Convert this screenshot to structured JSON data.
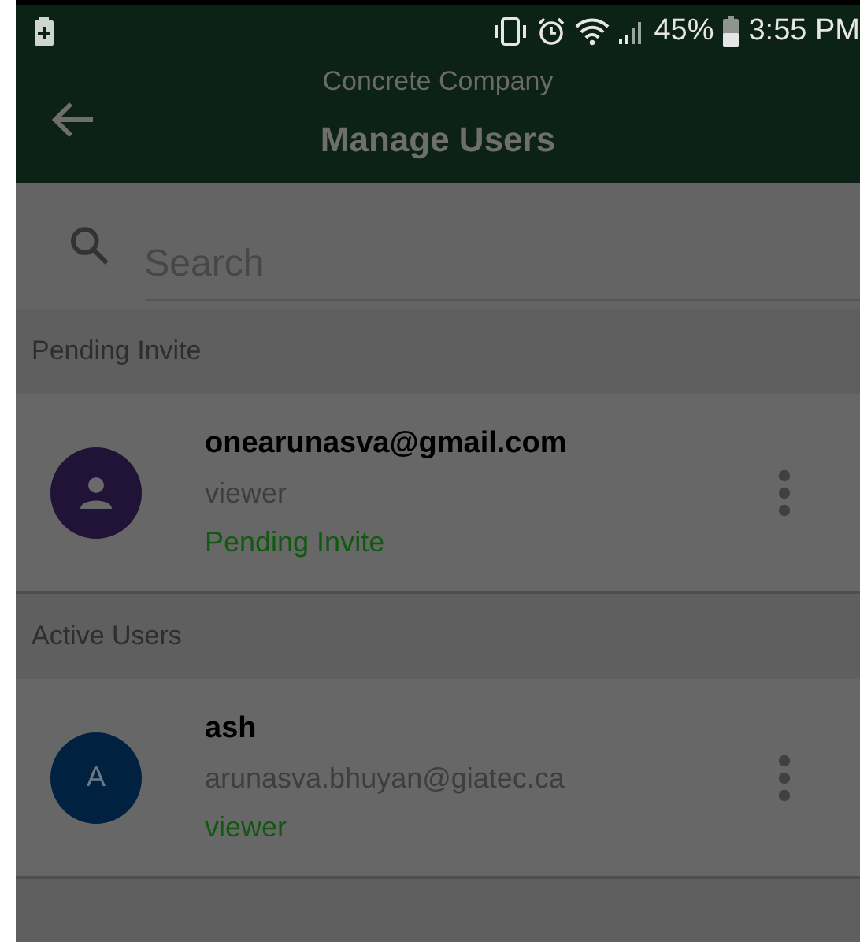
{
  "status_bar": {
    "battery_percent": "45%",
    "time": "3:55 PM"
  },
  "header": {
    "subtitle": "Concrete Company",
    "title": "Manage Users"
  },
  "search": {
    "placeholder": "Search"
  },
  "sections": [
    {
      "title": "Pending Invite",
      "users": [
        {
          "avatar": {
            "kind": "icon",
            "color": "#211238"
          },
          "name": "onearunasva@gmail.com",
          "line_2": "viewer",
          "line_3": "Pending Invite"
        }
      ]
    },
    {
      "title": "Active Users",
      "users": [
        {
          "avatar": {
            "kind": "initial",
            "text": "A",
            "color": "#00213f"
          },
          "name": "ash",
          "line_2": "arunasva.bhuyan@giatec.ca",
          "line_3": "viewer"
        }
      ]
    }
  ]
}
